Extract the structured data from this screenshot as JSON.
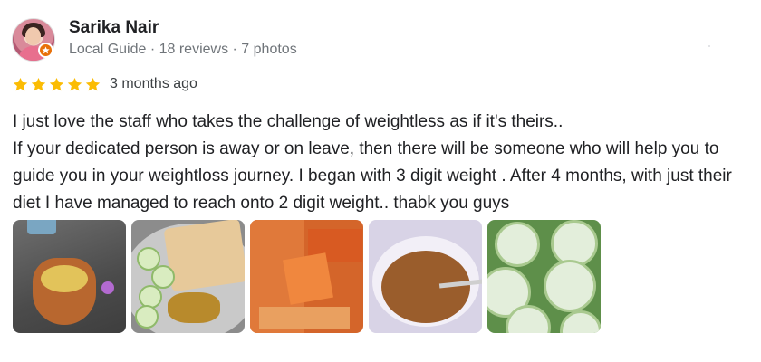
{
  "reviewer": {
    "name": "Sarika Nair",
    "meta": "Local Guide · 18 reviews · 7 photos",
    "avatar_icon": "profile-avatar",
    "badge_icon": "local-guide-badge-icon"
  },
  "rating": {
    "stars": 5,
    "max_stars": 5,
    "star_color": "#fbbc04",
    "date": "3 months ago"
  },
  "review_text": "I just love the staff who takes the challenge of weightless as if it's theirs..\nIf your dedicated person is away or on leave, then there will be someone who will help you to guide you in your weightloss journey. I began with 3 digit weight . After 4 months, with just their diet I have managed to reach onto 2 digit weight.. thabk you guys",
  "photos": [
    {
      "icon": "photo-clay-pot-drink"
    },
    {
      "icon": "photo-roti-cucumber-sabzi"
    },
    {
      "icon": "photo-papaya-slices"
    },
    {
      "icon": "photo-soup-bowl"
    },
    {
      "icon": "photo-cucumber-slices"
    }
  ],
  "colors": {
    "name": "#202124",
    "meta": "#70757a",
    "badge": "#e8710a"
  }
}
